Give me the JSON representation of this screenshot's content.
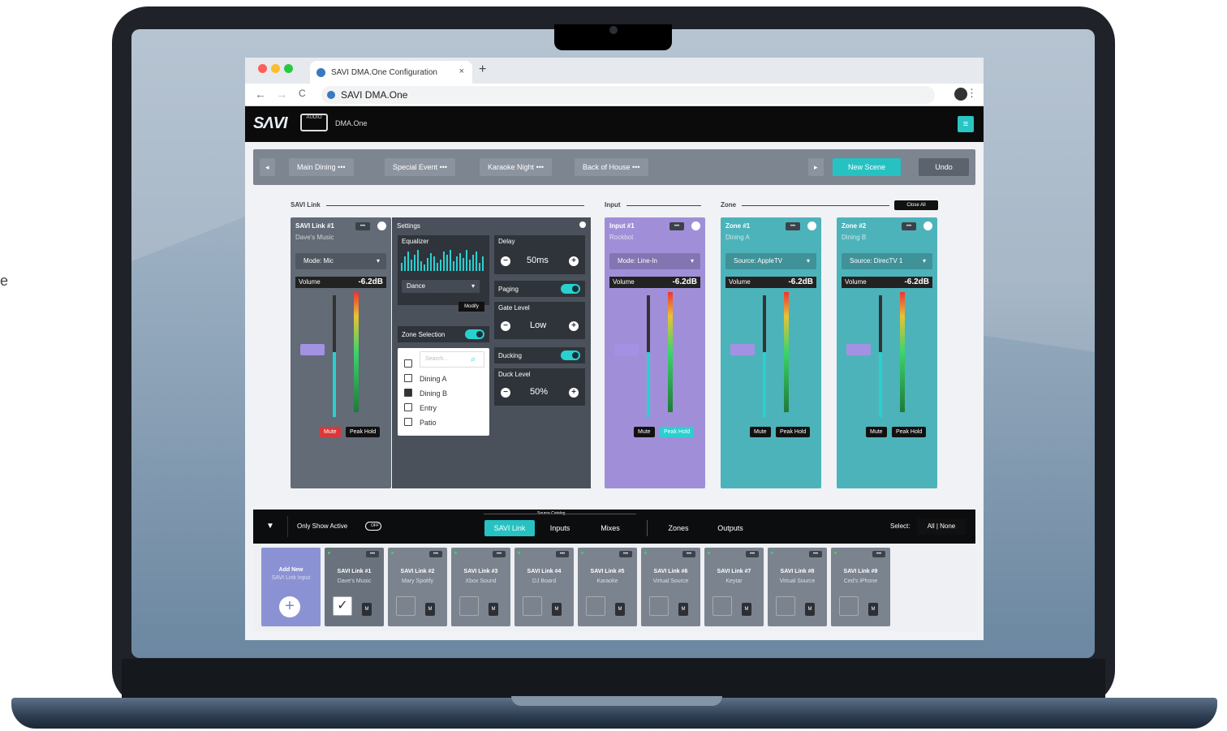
{
  "side_text": "e",
  "browser": {
    "tab_title": "SAVI DMA.One Configuration",
    "tab_close": "×",
    "new_tab": "+",
    "url": "SAVI DMA.One",
    "back": "←",
    "forward": "→",
    "reload": "C",
    "kebab": "⋮"
  },
  "app": {
    "logo": "SΛVI",
    "logo_box": "AUDIO",
    "name": "DMA.One",
    "menu_icon": "≡"
  },
  "scenes": {
    "prev": "◂",
    "next": "▸",
    "items": [
      "Main Dining",
      "Special Event",
      "Karaoke Night",
      "Back of House"
    ],
    "more": "•••",
    "new_scene": "New Scene",
    "undo": "Undo"
  },
  "sections": {
    "savi_link": "SAVI Link",
    "input": "Input",
    "zone": "Zone",
    "close_all": "Close All"
  },
  "channels": [
    {
      "title": "SAVI Link #1",
      "subtitle": "Dave's Music",
      "selector": "Mode: Mic",
      "volume_label": "Volume",
      "volume": "-6.2dB",
      "mute": "Mute",
      "peak": "Peak Hold",
      "color": "#626b76"
    },
    {
      "title": "Input #1",
      "subtitle": "Rockbot",
      "selector": "Mode: Line-In",
      "volume_label": "Volume",
      "volume": "-6.2dB",
      "mute": "Mute",
      "peak": "Peak Hold",
      "color": "#a08fd8"
    },
    {
      "title": "Zone #1",
      "subtitle": "Dining A",
      "selector": "Source: AppleTV",
      "volume_label": "Volume",
      "volume": "-6.2dB",
      "mute": "Mute",
      "peak": "Peak Hold",
      "color": "#4db3ba"
    },
    {
      "title": "Zone #2",
      "subtitle": "Dining B",
      "selector": "Source: DirecTV 1",
      "volume_label": "Volume",
      "volume": "-6.2dB",
      "mute": "Mute",
      "peak": "Peak Hold",
      "color": "#4db3ba"
    }
  ],
  "settings": {
    "title": "Settings",
    "equalizer": "Equalizer",
    "eq_preset": "Dance",
    "modify": "Modify",
    "zone_selection": "Zone Selection",
    "search_placeholder": "Search...",
    "zones": [
      {
        "label": "Dining A",
        "checked": false
      },
      {
        "label": "Dining B",
        "checked": true
      },
      {
        "label": "Entry",
        "checked": false
      },
      {
        "label": "Patio",
        "checked": false
      }
    ],
    "delay_label": "Delay",
    "delay": "50ms",
    "paging": "Paging",
    "gate_label": "Gate Level",
    "gate": "Low",
    "ducking": "Ducking",
    "duck_label": "Duck Level",
    "duck": "50%",
    "minus": "−",
    "plus": "+"
  },
  "catalog": {
    "only_active": "Only Show Active",
    "toggle_text": "OFF",
    "heading": "Source Catalog",
    "tabs": [
      "SAVI Link",
      "Inputs",
      "Mixes"
    ],
    "tabs2": [
      "Zones",
      "Outputs"
    ],
    "select_label": "Select:",
    "select_value": "All | None"
  },
  "tray": {
    "add_title": "Add New",
    "add_sub": "SAVI Link Input",
    "cards": [
      {
        "title": "SAVI Link #1",
        "sub": "Dave's Music",
        "checked": true
      },
      {
        "title": "SAVI Link #2",
        "sub": "Mary Spotify",
        "checked": false
      },
      {
        "title": "SAVI Link #3",
        "sub": "Xbox Sound",
        "checked": false
      },
      {
        "title": "SAVI Link #4",
        "sub": "DJ Board",
        "checked": false
      },
      {
        "title": "SAVI Link #5",
        "sub": "Karaoke",
        "checked": false
      },
      {
        "title": "SAVI Link #6",
        "sub": "Virtual Source",
        "checked": false
      },
      {
        "title": "SAVI Link #7",
        "sub": "Keytar",
        "checked": false
      },
      {
        "title": "SAVI Link #8",
        "sub": "Virtual Source",
        "checked": false
      },
      {
        "title": "SAVI Link #9",
        "sub": "Ced's iPhone",
        "checked": false
      }
    ],
    "m": "M"
  }
}
